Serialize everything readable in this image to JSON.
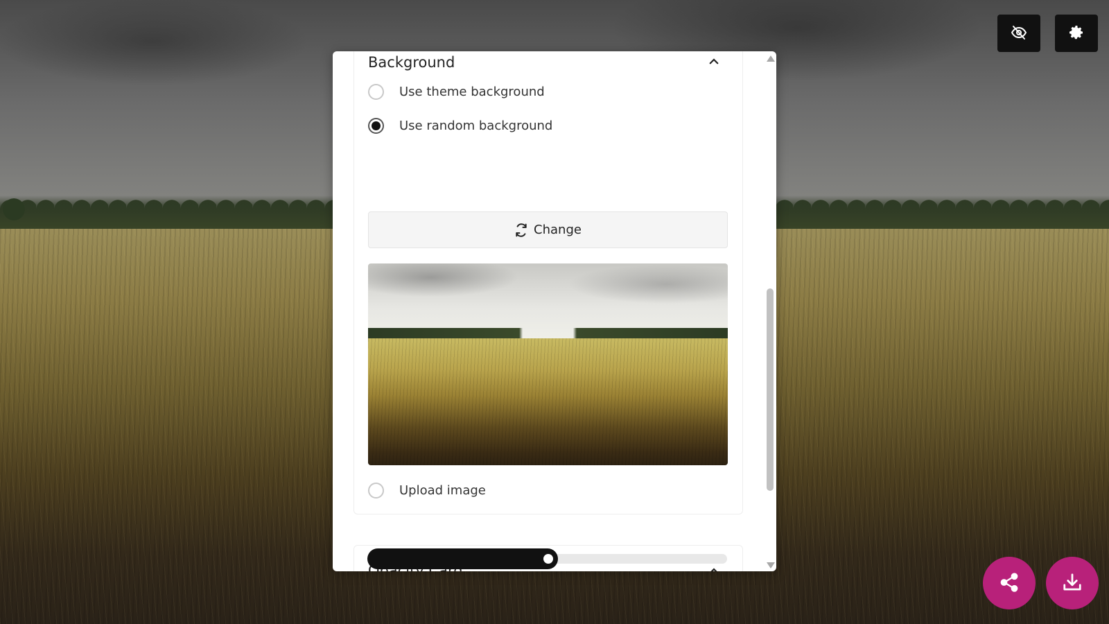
{
  "toolbar": {
    "hide_icon": "eye-slash-icon",
    "settings_icon": "gear-icon"
  },
  "fabs": {
    "share_icon": "share-icon",
    "download_icon": "download-icon",
    "color": "#b8217a"
  },
  "panel": {
    "background_section": {
      "title": "Background",
      "options": [
        {
          "label": "Use theme background",
          "checked": false
        },
        {
          "label": "Use random background",
          "checked": true
        },
        {
          "label": "Upload image",
          "checked": false
        }
      ],
      "change_label": "Change",
      "change_icon": "refresh-icon",
      "preview_icon": "image-preview"
    },
    "opacity_section": {
      "title": "Opacity Card",
      "slider_value_fraction": 0.53
    }
  }
}
